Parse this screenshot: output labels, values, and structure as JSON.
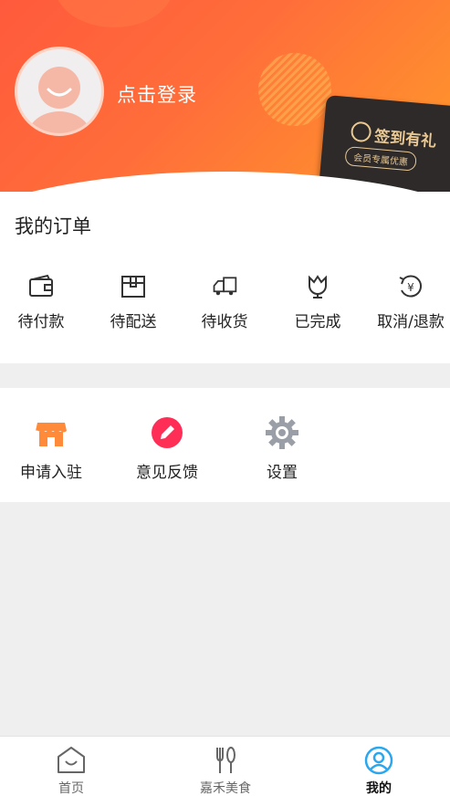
{
  "header": {
    "login_text": "点击登录",
    "signin_title": "签到有礼",
    "signin_subtitle": "会员专属优惠"
  },
  "orders": {
    "title": "我的订单",
    "items": [
      {
        "label": "待付款",
        "icon": "wallet-icon"
      },
      {
        "label": "待配送",
        "icon": "package-icon"
      },
      {
        "label": "待收货",
        "icon": "truck-icon"
      },
      {
        "label": "已完成",
        "icon": "tulip-icon"
      },
      {
        "label": "取消/退款",
        "icon": "refund-icon"
      }
    ]
  },
  "tools": {
    "items": [
      {
        "label": "申请入驻",
        "icon": "storefront-icon"
      },
      {
        "label": "意见反馈",
        "icon": "pencil-icon"
      },
      {
        "label": "设置",
        "icon": "gear-icon"
      }
    ]
  },
  "tabbar": {
    "tabs": [
      {
        "label": "首页",
        "icon": "home-icon"
      },
      {
        "label": "嘉禾美食",
        "icon": "cutlery-icon"
      },
      {
        "label": "我的",
        "icon": "user-icon"
      }
    ],
    "active_index": 2
  },
  "colors": {
    "header_start": "#ff5a3c",
    "header_end": "#ff9a2a",
    "store_orange": "#ff8a3a",
    "feedback_red": "#ff2e57",
    "gear_gray": "#9a9ea6",
    "active_tab": "#2aa7ee"
  }
}
